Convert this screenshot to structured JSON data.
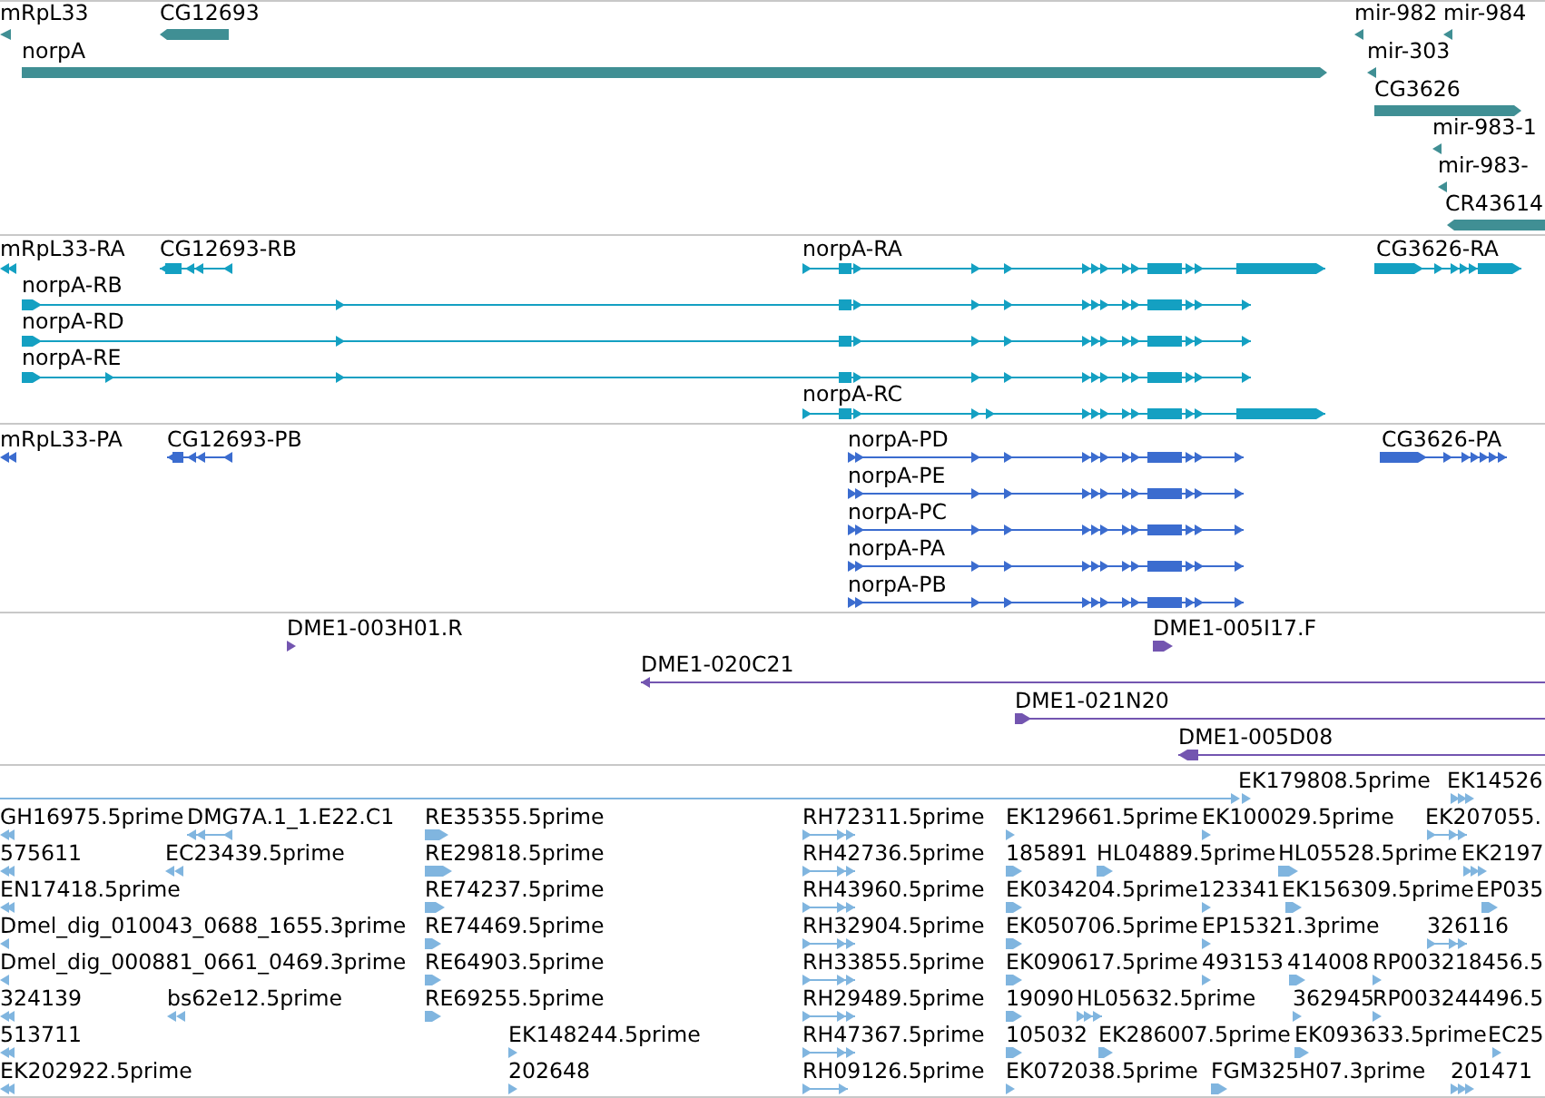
{
  "tracks": [
    {
      "kind": "genes",
      "color": "#408f94",
      "features": [
        {
          "label": "mRpL33",
          "reverse": true
        },
        {
          "label": "CG12693",
          "reverse": true
        },
        {
          "label": "mir-982",
          "reverse": true
        },
        {
          "label": "mir-984",
          "reverse": true
        },
        {
          "label": "norpA",
          "reverse": false
        },
        {
          "label": "mir-303",
          "reverse": true
        },
        {
          "label": "CG3626",
          "reverse": false
        },
        {
          "label": "mir-983-1",
          "reverse": true
        },
        {
          "label": "mir-983-",
          "reverse": true
        },
        {
          "label": "CR43614",
          "reverse": true
        }
      ]
    },
    {
      "kind": "transcripts",
      "color": "#14a0c2",
      "features": [
        {
          "label": "mRpL33-RA",
          "reverse": true
        },
        {
          "label": "CG12693-RB",
          "reverse": true
        },
        {
          "label": "norpA-RA",
          "reverse": false
        },
        {
          "label": "CG3626-RA",
          "reverse": false
        },
        {
          "label": "norpA-RB",
          "reverse": false
        },
        {
          "label": "norpA-RD",
          "reverse": false
        },
        {
          "label": "norpA-RE",
          "reverse": false
        },
        {
          "label": "norpA-RC",
          "reverse": false
        }
      ]
    },
    {
      "kind": "proteins",
      "color": "#3b6ccf",
      "features": [
        {
          "label": "mRpL33-PA",
          "reverse": true
        },
        {
          "label": "CG12693-PB",
          "reverse": true
        },
        {
          "label": "norpA-PD",
          "reverse": false
        },
        {
          "label": "CG3626-PA",
          "reverse": false
        },
        {
          "label": "norpA-PE",
          "reverse": false
        },
        {
          "label": "norpA-PC",
          "reverse": false
        },
        {
          "label": "norpA-PA",
          "reverse": false
        },
        {
          "label": "norpA-PB",
          "reverse": false
        }
      ]
    },
    {
      "kind": "clones",
      "color": "#7355b0",
      "features": [
        {
          "label": "DME1-003H01.R",
          "reverse": false
        },
        {
          "label": "DME1-005I17.F",
          "reverse": false
        },
        {
          "label": "DME1-020C21",
          "reverse": true
        },
        {
          "label": "DME1-021N20",
          "reverse": false
        },
        {
          "label": "DME1-005D08",
          "reverse": true
        }
      ]
    },
    {
      "kind": "ests",
      "color": "#80b5df",
      "features": [
        {
          "label": "EK179808.5prime",
          "reverse": false
        },
        {
          "label": "EK14526",
          "reverse": false
        },
        {
          "label": "GH16975.5prime",
          "reverse": true
        },
        {
          "label": "DMG7A.1_1.E22.C1",
          "reverse": true
        },
        {
          "label": "RE35355.5prime",
          "reverse": false
        },
        {
          "label": "RH72311.5prime",
          "reverse": false
        },
        {
          "label": "EK129661.5prime",
          "reverse": false
        },
        {
          "label": "EK100029.5prime",
          "reverse": false
        },
        {
          "label": "EK207055.",
          "reverse": false
        },
        {
          "label": "575611",
          "reverse": true
        },
        {
          "label": "EC23439.5prime",
          "reverse": true
        },
        {
          "label": "RE29818.5prime",
          "reverse": false
        },
        {
          "label": "RH42736.5prime",
          "reverse": false
        },
        {
          "label": "185891",
          "reverse": false
        },
        {
          "label": "HL04889.5prime",
          "reverse": false
        },
        {
          "label": "HL05528.5prime",
          "reverse": false
        },
        {
          "label": "EK2197",
          "reverse": false
        },
        {
          "label": "EN17418.5prime",
          "reverse": true
        },
        {
          "label": "RE74237.5prime",
          "reverse": false
        },
        {
          "label": "RH43960.5prime",
          "reverse": false
        },
        {
          "label": "EK034204.5prime",
          "reverse": false
        },
        {
          "label": "123341",
          "reverse": false
        },
        {
          "label": "EK156309.5prime",
          "reverse": false
        },
        {
          "label": "EP035",
          "reverse": false
        },
        {
          "label": "Dmel_dig_010043_0688_1655.3prime",
          "reverse": true
        },
        {
          "label": "RE74469.5prime",
          "reverse": false
        },
        {
          "label": "RH32904.5prime",
          "reverse": false
        },
        {
          "label": "EK050706.5prime",
          "reverse": false
        },
        {
          "label": "EP15321.3prime",
          "reverse": false
        },
        {
          "label": "326116",
          "reverse": false
        },
        {
          "label": "Dmel_dig_000881_0661_0469.3prime",
          "reverse": true
        },
        {
          "label": "RE64903.5prime",
          "reverse": false
        },
        {
          "label": "RH33855.5prime",
          "reverse": false
        },
        {
          "label": "EK090617.5prime",
          "reverse": false
        },
        {
          "label": "493153",
          "reverse": false
        },
        {
          "label": "414008",
          "reverse": false
        },
        {
          "label": "RP003218456.5",
          "reverse": false
        },
        {
          "label": "324139",
          "reverse": true
        },
        {
          "label": "bs62e12.5prime",
          "reverse": true
        },
        {
          "label": "RE69255.5prime",
          "reverse": false
        },
        {
          "label": "RH29489.5prime",
          "reverse": false
        },
        {
          "label": "19090",
          "reverse": false
        },
        {
          "label": "HL05632.5prime",
          "reverse": false
        },
        {
          "label": "362945",
          "reverse": false
        },
        {
          "label": "RP003244496.5",
          "reverse": false
        },
        {
          "label": "513711",
          "reverse": true
        },
        {
          "label": "EK148244.5prime",
          "reverse": false
        },
        {
          "label": "RH47367.5prime",
          "reverse": false
        },
        {
          "label": "105032",
          "reverse": false
        },
        {
          "label": "EK286007.5prime",
          "reverse": false
        },
        {
          "label": "EK093633.5prime",
          "reverse": false
        },
        {
          "label": "EC25",
          "reverse": false
        },
        {
          "label": "EK202922.5prime",
          "reverse": true
        },
        {
          "label": "202648",
          "reverse": false
        },
        {
          "label": "RH09126.5prime",
          "reverse": false
        },
        {
          "label": "EK072038.5prime",
          "reverse": false
        },
        {
          "label": "FGM325H07.3prime",
          "reverse": false
        },
        {
          "label": "201471",
          "reverse": false
        }
      ]
    }
  ]
}
